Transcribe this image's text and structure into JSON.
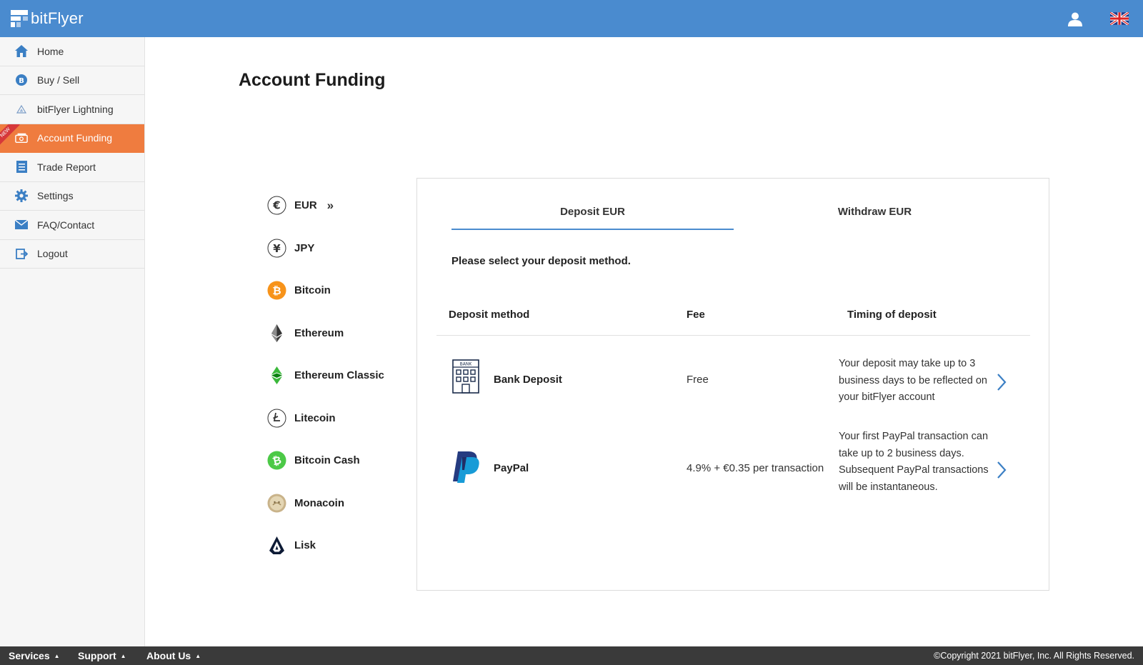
{
  "header": {
    "logo_text": "bitFlyer",
    "user_icon": "user-icon",
    "language_icon": "uk-flag-icon"
  },
  "sidebar": {
    "items": [
      {
        "label": "Home",
        "icon": "home-icon"
      },
      {
        "label": "Buy / Sell",
        "icon": "bitcoin-icon"
      },
      {
        "label": "bitFlyer Lightning",
        "icon": "lightning-icon"
      },
      {
        "label": "Account Funding",
        "icon": "wallet-icon",
        "active": true,
        "badge": "NEW"
      },
      {
        "label": "Trade Report",
        "icon": "report-icon"
      },
      {
        "label": "Settings",
        "icon": "gear-icon"
      },
      {
        "label": "FAQ/Contact",
        "icon": "mail-icon"
      },
      {
        "label": "Logout",
        "icon": "logout-icon"
      }
    ]
  },
  "main": {
    "title": "Account Funding",
    "currencies": [
      {
        "label": "EUR",
        "icon": "euro-icon",
        "selected": true
      },
      {
        "label": "JPY",
        "icon": "yen-icon"
      },
      {
        "label": "Bitcoin",
        "icon": "bitcoin-icon"
      },
      {
        "label": "Ethereum",
        "icon": "ethereum-icon"
      },
      {
        "label": "Ethereum Classic",
        "icon": "ethereum-classic-icon"
      },
      {
        "label": "Litecoin",
        "icon": "litecoin-icon"
      },
      {
        "label": "Bitcoin Cash",
        "icon": "bitcoin-cash-icon"
      },
      {
        "label": "Monacoin",
        "icon": "monacoin-icon"
      },
      {
        "label": "Lisk",
        "icon": "lisk-icon"
      }
    ],
    "tabs": {
      "deposit": "Deposit EUR",
      "withdraw": "Withdraw EUR"
    },
    "instruction": "Please select your deposit method.",
    "table": {
      "headers": [
        "Deposit method",
        "Fee",
        "Timing of deposit"
      ],
      "rows": [
        {
          "method": "Bank Deposit",
          "icon": "bank-icon",
          "fee": "Free",
          "timing": "Your deposit may take up to 3 business days to be reflected on your bitFlyer account"
        },
        {
          "method": "PayPal",
          "icon": "paypal-icon",
          "fee": "4.9% + €0.35 per transaction",
          "timing": "Your first PayPal transaction can take up to 2 business days. Subsequent PayPal transactions will be instantaneous."
        }
      ]
    }
  },
  "footer": {
    "links": [
      "Services",
      "Support",
      "About Us"
    ],
    "copyright": "©Copyright 2021 bitFlyer, Inc. All Rights Reserved."
  },
  "colors": {
    "header_bg": "#4a8bcf",
    "active_nav": "#ef7c3f",
    "new_badge": "#d6383a",
    "footer_bg": "#3a3a3a",
    "tab_underline": "#4a8bcf"
  }
}
